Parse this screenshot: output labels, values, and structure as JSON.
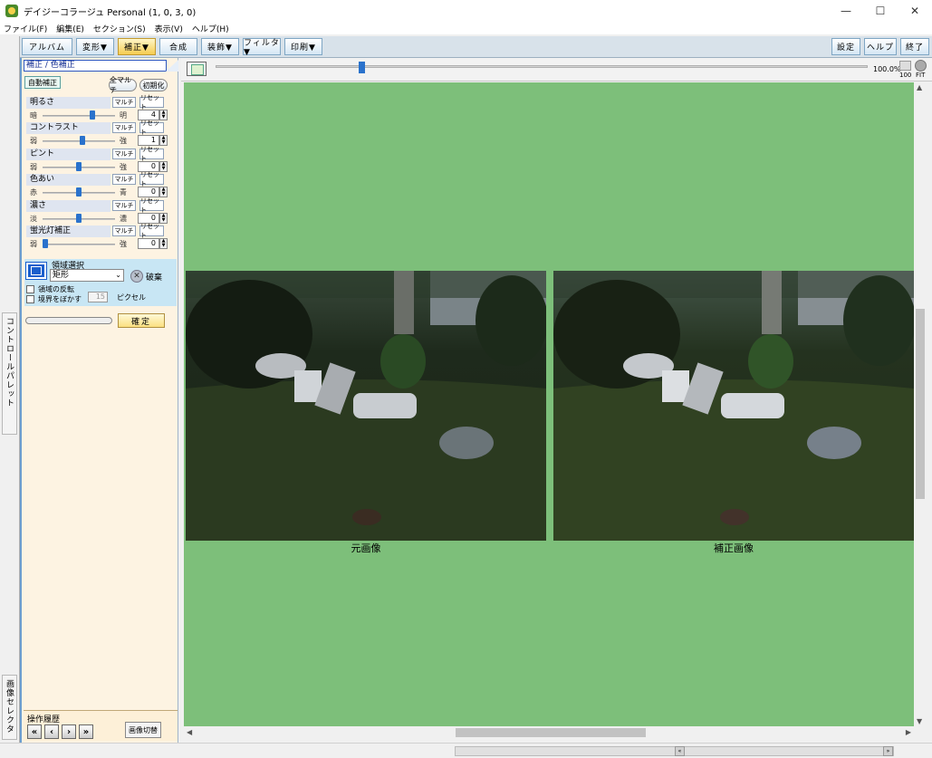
{
  "window": {
    "title": "デイジーコラージュ Personal (1, 0, 3, 0)",
    "minimize_glyph": "—",
    "maximize_glyph": "☐",
    "close_glyph": "✕"
  },
  "menu": [
    "ファイル(F)",
    "編集(E)",
    "セクション(S)",
    "表示(V)",
    "ヘルプ(H)"
  ],
  "toolbar": {
    "album": "アルバム",
    "transform": "変形▼",
    "correct": "補正▼",
    "composite": "合成",
    "decorate": "装飾▼",
    "filter": "フィルタ▼",
    "print": "印刷▼",
    "settings": "設定",
    "help": "ヘルプ",
    "exit": "終了"
  },
  "side_tabs": {
    "control_palette": "コントロールパレット",
    "image_selector": "画像セレクタ"
  },
  "panel": {
    "header": "補正 / 色補正",
    "auto_correct": "自動補正",
    "all_multi": "全マルチ",
    "initialize": "初期化",
    "multi_label": "マルチ",
    "reset_label": "リセット",
    "adjustments": [
      {
        "label": "明るさ",
        "lo": "暗",
        "hi": "明",
        "value": "4",
        "level": 0.7
      },
      {
        "label": "コントラスト",
        "lo": "弱",
        "hi": "強",
        "value": "1",
        "level": 0.55
      },
      {
        "label": "ピント",
        "lo": "弱",
        "hi": "強",
        "value": "0",
        "level": 0.5
      },
      {
        "label": "色あい",
        "lo": "赤",
        "hi": "青",
        "value": "0",
        "level": 0.5
      },
      {
        "label": "濃さ",
        "lo": "淡",
        "hi": "濃",
        "value": "0",
        "level": 0.5
      },
      {
        "label": "蛍光灯補正",
        "lo": "弱",
        "hi": "強",
        "value": "0",
        "level": 0.0
      }
    ],
    "region": {
      "title": "領域選択",
      "shape": "矩形",
      "discard": "破棄",
      "invert": "領域の反転",
      "blur_edge": "境界をぼかす",
      "blur_value": "15",
      "blur_unit": "ピクセル"
    },
    "confirm": "確定",
    "history": {
      "label": "操作履歴",
      "first": "«",
      "prev": "‹",
      "next": "›",
      "last": "»",
      "switch_image": "画像切替"
    }
  },
  "zoom": {
    "percent": "100.0%",
    "label_100": "100",
    "label_fit": "FIT",
    "level": 0.22
  },
  "canvas": {
    "original_caption": "元画像",
    "corrected_caption": "補正画像"
  },
  "colors": {
    "canvas_bg": "#7dbf7a",
    "accent": "#2a72cc",
    "panel_bg": "#fdf3e2"
  }
}
